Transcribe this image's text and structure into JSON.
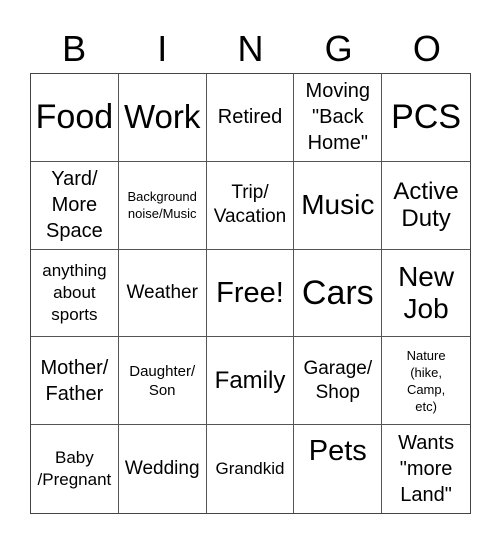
{
  "header": {
    "letters": [
      "B",
      "I",
      "N",
      "G",
      "O"
    ]
  },
  "card": {
    "rows": [
      [
        {
          "text": "Food",
          "size": "s34"
        },
        {
          "text": "Work",
          "size": "s33"
        },
        {
          "text": "Retired",
          "size": "s20"
        },
        {
          "text": "Moving\n\"Back\nHome\"",
          "size": "s20"
        },
        {
          "text": "PCS",
          "size": "s34"
        }
      ],
      [
        {
          "text": "Yard/\nMore\nSpace",
          "size": "s20"
        },
        {
          "text": "Background\nnoise/Music",
          "size": "s13"
        },
        {
          "text": "Trip/\nVacation",
          "size": "s19"
        },
        {
          "text": "Music",
          "size": "s28"
        },
        {
          "text": "Active\nDuty",
          "size": "s24"
        }
      ],
      [
        {
          "text": "anything\nabout\nsports",
          "size": "s17"
        },
        {
          "text": "Weather",
          "size": "s19"
        },
        {
          "text": "Free!",
          "size": "s29"
        },
        {
          "text": "Cars",
          "size": "s34"
        },
        {
          "text": "New\nJob",
          "size": "s28"
        }
      ],
      [
        {
          "text": "Mother/\nFather",
          "size": "s20"
        },
        {
          "text": "Daughter/\nSon",
          "size": "s15"
        },
        {
          "text": "Family",
          "size": "s24"
        },
        {
          "text": "Garage/\nShop",
          "size": "s19"
        },
        {
          "text": "Nature\n(hike,\nCamp,\netc)",
          "size": "s13"
        }
      ],
      [
        {
          "text": "Baby\n/Pregnant",
          "size": "s17"
        },
        {
          "text": "Wedding",
          "size": "s19"
        },
        {
          "text": "Grandkid",
          "size": "s17"
        },
        {
          "text": "Pets",
          "size": "s29",
          "align": "top"
        },
        {
          "text": "Wants\n\"more\nLand\"",
          "size": "s20"
        }
      ]
    ]
  }
}
